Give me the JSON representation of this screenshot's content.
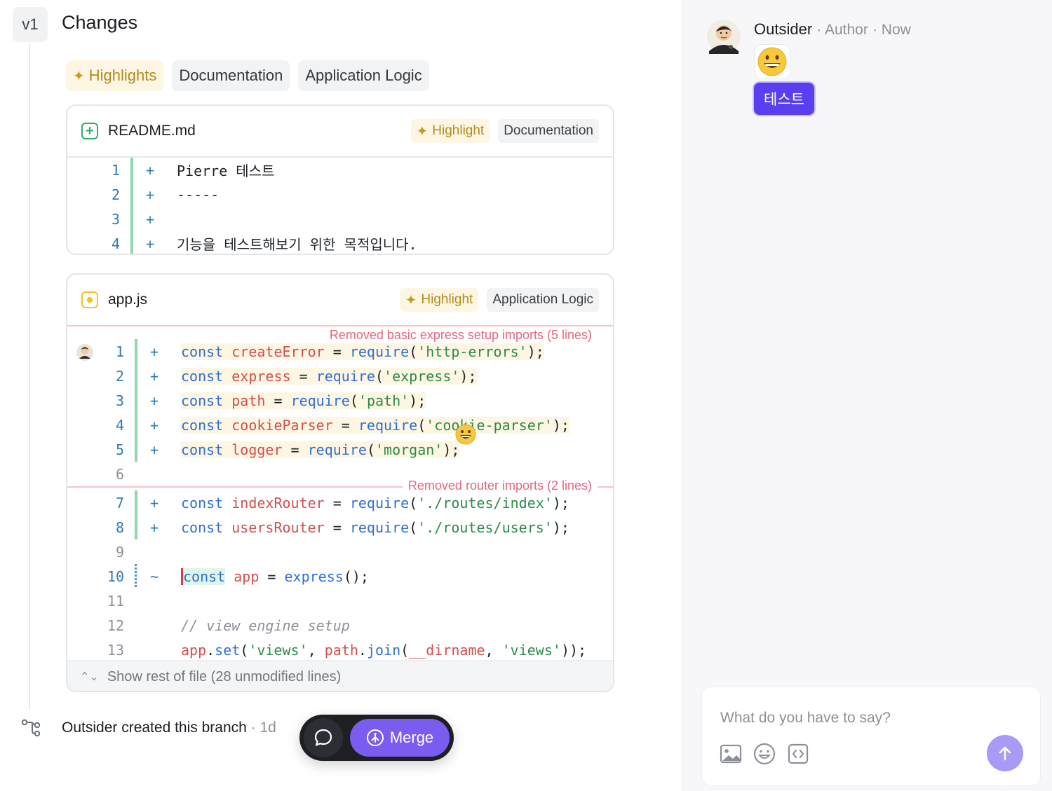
{
  "header": {
    "version": "v1",
    "title": "Changes"
  },
  "tabs": [
    {
      "label": "Highlights"
    },
    {
      "label": "Documentation"
    },
    {
      "label": "Application Logic"
    }
  ],
  "files": [
    {
      "name": "README.md",
      "status_icon": "file-added-icon",
      "chips": [
        "Highlight",
        "Documentation"
      ],
      "lines": [
        {
          "n": "1",
          "sign": "+",
          "text": "Pierre 테스트"
        },
        {
          "n": "2",
          "sign": "+",
          "text": "-----"
        },
        {
          "n": "3",
          "sign": "+",
          "text": ""
        },
        {
          "n": "4",
          "sign": "+",
          "text": "기능을 테스트해보기 위한 목적입니다."
        }
      ]
    },
    {
      "name": "app.js",
      "status_icon": "file-modified-icon",
      "chips": [
        "Highlight",
        "Application Logic"
      ],
      "annotations": [
        "Removed basic express setup imports (5 lines)",
        "Removed router imports (2 lines)"
      ],
      "lines": [
        {
          "n": "1",
          "sign": "+",
          "tokens": [
            [
              "kw",
              "const"
            ],
            [
              "p",
              " "
            ],
            [
              "id",
              "createError"
            ],
            [
              "p",
              " = "
            ],
            [
              "fn",
              "require"
            ],
            [
              "p",
              "("
            ],
            [
              "str",
              "'http-errors'"
            ],
            [
              "p",
              ");"
            ]
          ]
        },
        {
          "n": "2",
          "sign": "+",
          "tokens": [
            [
              "kw",
              "const"
            ],
            [
              "p",
              " "
            ],
            [
              "id",
              "express"
            ],
            [
              "p",
              " = "
            ],
            [
              "fn",
              "require"
            ],
            [
              "p",
              "("
            ],
            [
              "str",
              "'express'"
            ],
            [
              "p",
              ");"
            ]
          ]
        },
        {
          "n": "3",
          "sign": "+",
          "tokens": [
            [
              "kw",
              "const"
            ],
            [
              "p",
              " "
            ],
            [
              "id",
              "path"
            ],
            [
              "p",
              " = "
            ],
            [
              "fn",
              "require"
            ],
            [
              "p",
              "("
            ],
            [
              "str",
              "'path'"
            ],
            [
              "p",
              ");"
            ]
          ]
        },
        {
          "n": "4",
          "sign": "+",
          "tokens": [
            [
              "kw",
              "const"
            ],
            [
              "p",
              " "
            ],
            [
              "id",
              "cookieParser"
            ],
            [
              "p",
              " = "
            ],
            [
              "fn",
              "require"
            ],
            [
              "p",
              "("
            ],
            [
              "str",
              "'cookie-parser'"
            ],
            [
              "p",
              ");"
            ]
          ]
        },
        {
          "n": "5",
          "sign": "+",
          "tokens": [
            [
              "kw",
              "const"
            ],
            [
              "p",
              " "
            ],
            [
              "id",
              "logger"
            ],
            [
              "p",
              " = "
            ],
            [
              "fn",
              "require"
            ],
            [
              "p",
              "("
            ],
            [
              "str",
              "'morgan'"
            ],
            [
              "p",
              ");"
            ]
          ]
        },
        {
          "n": "6",
          "sign": "",
          "tokens": []
        },
        {
          "n": "7",
          "sign": "+",
          "tokens": [
            [
              "kw",
              "const"
            ],
            [
              "p",
              " "
            ],
            [
              "id",
              "indexRouter"
            ],
            [
              "p",
              " = "
            ],
            [
              "fn",
              "require"
            ],
            [
              "p",
              "("
            ],
            [
              "str",
              "'./routes/index'"
            ],
            [
              "p",
              ");"
            ]
          ]
        },
        {
          "n": "8",
          "sign": "+",
          "tokens": [
            [
              "kw",
              "const"
            ],
            [
              "p",
              " "
            ],
            [
              "id",
              "usersRouter"
            ],
            [
              "p",
              " = "
            ],
            [
              "fn",
              "require"
            ],
            [
              "p",
              "("
            ],
            [
              "str",
              "'./routes/users'"
            ],
            [
              "p",
              ");"
            ]
          ]
        },
        {
          "n": "9",
          "sign": "",
          "tokens": []
        },
        {
          "n": "10",
          "sign": "~",
          "tokens": [
            [
              "kw",
              "const"
            ],
            [
              "p",
              " "
            ],
            [
              "id",
              "app"
            ],
            [
              "p",
              " = "
            ],
            [
              "fn",
              "express"
            ],
            [
              "p",
              "();"
            ]
          ]
        },
        {
          "n": "11",
          "sign": "",
          "tokens": []
        },
        {
          "n": "12",
          "sign": "",
          "tokens": [
            [
              "cm",
              "// view engine setup"
            ]
          ]
        },
        {
          "n": "13",
          "sign": "",
          "tokens": [
            [
              "id",
              "app"
            ],
            [
              "p",
              "."
            ],
            [
              "fn",
              "set"
            ],
            [
              "p",
              "("
            ],
            [
              "str",
              "'views'"
            ],
            [
              "p",
              ", "
            ],
            [
              "id",
              "path"
            ],
            [
              "p",
              "."
            ],
            [
              "fn",
              "join"
            ],
            [
              "p",
              "("
            ],
            [
              "id",
              "__dirname"
            ],
            [
              "p",
              ", "
            ],
            [
              "str",
              "'views'"
            ],
            [
              "p",
              "));"
            ]
          ]
        }
      ],
      "show_rest": "Show rest of file (28 unmodified lines)"
    }
  ],
  "branch_event": {
    "text": "Outsider created this branch",
    "time": "1d"
  },
  "actions": {
    "merge_label": "Merge"
  },
  "comment": {
    "author": "Outsider",
    "role": "Author",
    "time": "Now",
    "reaction": "😀",
    "tag": "테스트"
  },
  "composer": {
    "placeholder": "What do you have to say?"
  },
  "colors": {
    "accent": "#7a5cf0",
    "tag": "#5a3ff0",
    "added": "#2fae6b",
    "annotation": "#e4667c"
  }
}
